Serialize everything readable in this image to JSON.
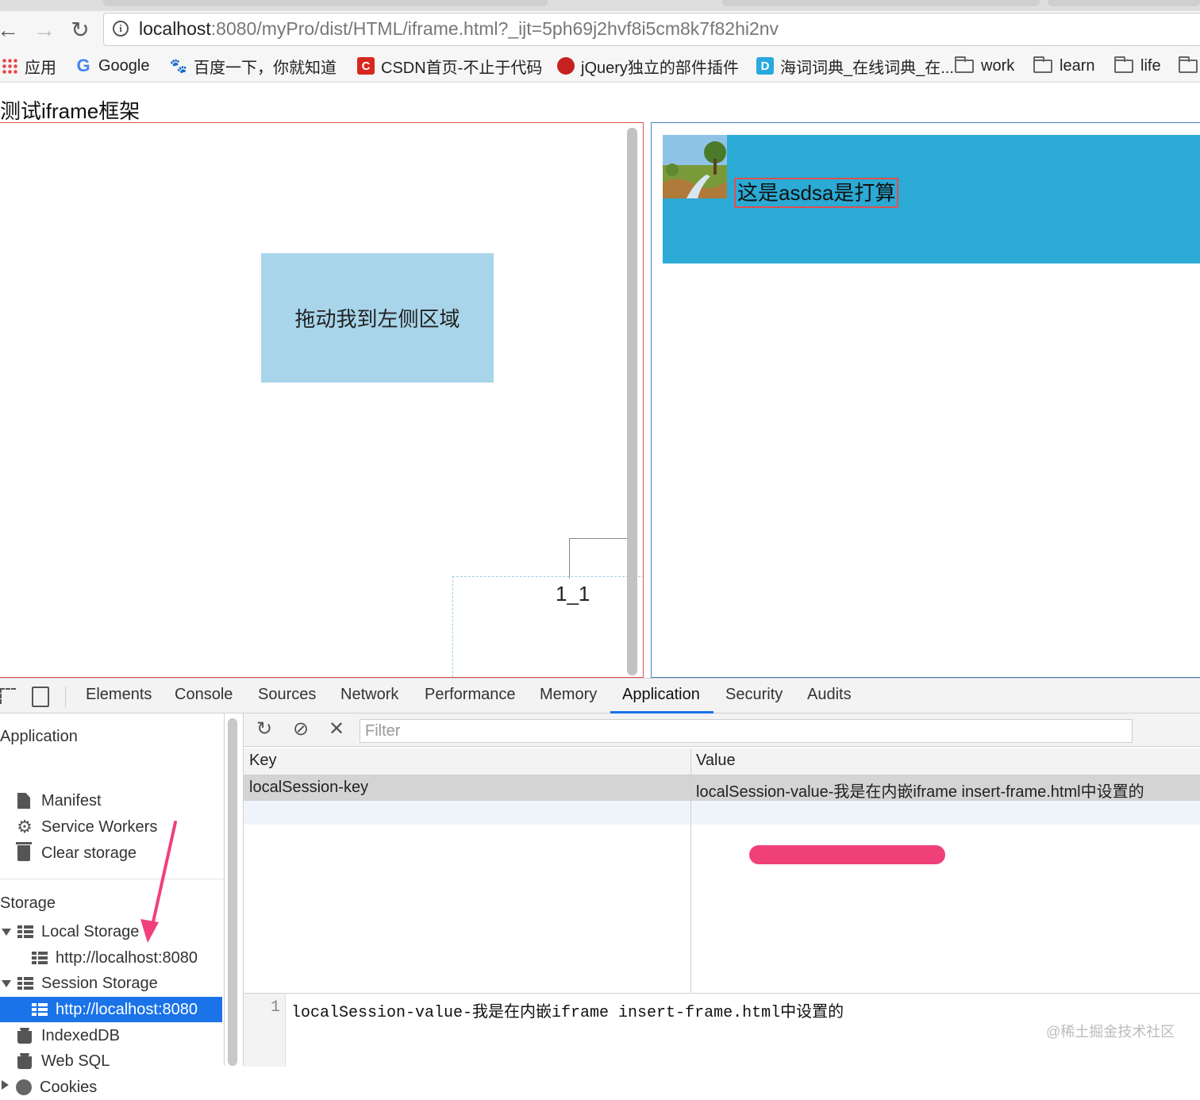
{
  "browser": {
    "url_host": "localhost",
    "url_rest": ":8080/myPro/dist/HTML/iframe.html?_ijt=5ph69j2hvf8i5cm8k7f82hi2nv",
    "info_glyph": "i",
    "back_glyph": "←",
    "forward_glyph": "→",
    "reload_glyph": "↻",
    "bookmarks": {
      "apps": "应用",
      "google": "Google",
      "baidu": "百度一下，你就知道",
      "csdn": "CSDN首页-不止于代码",
      "jquery": "jQuery独立的部件插件",
      "dict": "海词词典_在线词典_在...",
      "work": "work",
      "learn": "learn",
      "life": "life"
    },
    "bookmark_icons": {
      "google": "G",
      "csdn": "C",
      "dict": "D",
      "baidu": "🐾"
    }
  },
  "page": {
    "title": "测试iframe框架",
    "drag_box_text": "拖动我到左侧区域",
    "small_label": "1_1",
    "banner_text": "这是asdsa是打算"
  },
  "colors": {
    "drag_box": "#a8d5ea",
    "banner": "#2aaad4",
    "left_frame_border": "#d9534f",
    "right_frame_border": "#4a7fc1",
    "accent": "#1a73e8",
    "highlight": "#f0407a"
  },
  "devtools": {
    "tabs": [
      "Elements",
      "Console",
      "Sources",
      "Network",
      "Performance",
      "Memory",
      "Application",
      "Security",
      "Audits"
    ],
    "active_tab": "Application",
    "sidebar": {
      "application_header": "Application",
      "manifest": "Manifest",
      "service_workers": "Service Workers",
      "clear_storage": "Clear storage",
      "storage_header": "Storage",
      "local_storage": "Local Storage",
      "local_storage_origin": "http://localhost:8080",
      "session_storage": "Session Storage",
      "session_storage_origin": "http://localhost:8080",
      "indexeddb": "IndexedDB",
      "web_sql": "Web SQL",
      "cookies": "Cookies"
    },
    "toolbar": {
      "refresh_glyph": "↻",
      "clear_glyph": "⊘",
      "delete_glyph": "✕",
      "filter_placeholder": "Filter"
    },
    "table": {
      "headers": {
        "key": "Key",
        "value": "Value"
      },
      "rows": [
        {
          "key": "localSession-key",
          "value": "localSession-value-我是在内嵌iframe insert-frame.html中设置的"
        }
      ]
    },
    "preview": {
      "line_number": "1",
      "text": "localSession-value-我是在内嵌iframe insert-frame.html中设置的"
    }
  },
  "watermark": "@稀土掘金技术社区"
}
